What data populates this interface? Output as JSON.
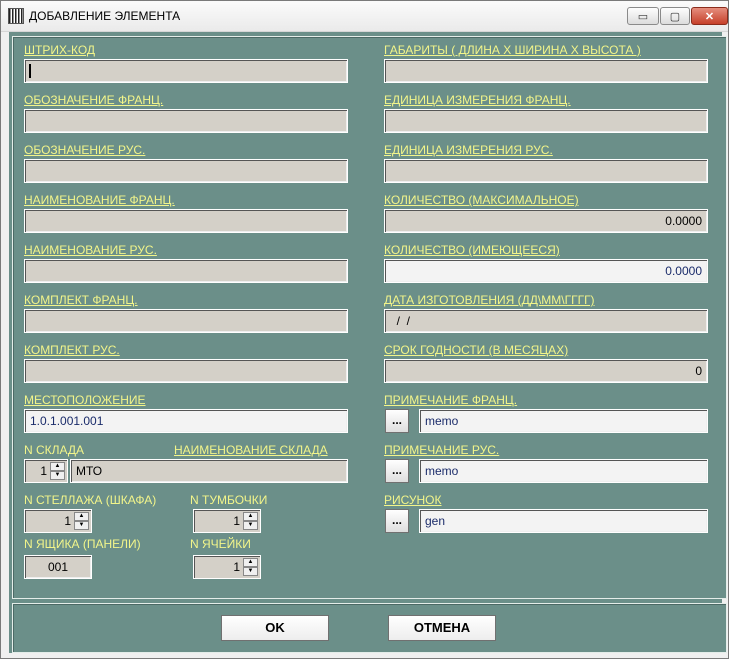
{
  "window": {
    "title": "ДОБАВЛЕНИЕ ЭЛЕМЕНТА",
    "minimize": "▭",
    "maximize": "▢",
    "close": "✕"
  },
  "left": {
    "barcode": {
      "label": "ШТРИХ-КОД",
      "value": ""
    },
    "designation_fr": {
      "label": "ОБОЗНАЧЕНИЕ  ФРАНЦ.",
      "value": ""
    },
    "designation_ru": {
      "label": "ОБОЗНАЧЕНИЕ  РУС.",
      "value": ""
    },
    "name_fr": {
      "label": "НАИМЕНОВАНИЕ  ФРАНЦ.",
      "value": ""
    },
    "name_ru": {
      "label": "НАИМЕНОВАНИЕ  РУС.",
      "value": ""
    },
    "kit_fr": {
      "label": "КОМПЛЕКТ  ФРАНЦ.",
      "value": ""
    },
    "kit_ru": {
      "label": "КОМПЛЕКТ  РУС.",
      "value": ""
    },
    "location": {
      "label": "МЕСТОПОЛОЖЕНИЕ",
      "value": "1.0.1.001.001"
    },
    "warehouse_no": {
      "label": "N  СКЛАДА",
      "value": "1"
    },
    "warehouse_name": {
      "label": "НАИМЕНОВАНИЕ СКЛАДА",
      "value": "МТО"
    },
    "rack_no": {
      "label": "N  СТЕЛЛАЖА (ШКАФА)",
      "value": "1"
    },
    "cabinet_no": {
      "label": "N  ТУМБОЧКИ",
      "value": "1"
    },
    "drawer_no": {
      "label": "N  ЯЩИКА (ПАНЕЛИ)",
      "value": "001"
    },
    "cell_no": {
      "label": "N  ЯЧЕЙКИ",
      "value": "1"
    }
  },
  "right": {
    "dimensions": {
      "label": "ГАБАРИТЫ ( ДЛИНА Х ШИРИНА Х ВЫСОТА )",
      "value": ""
    },
    "unit_fr": {
      "label": "ЕДИНИЦА ИЗМЕРЕНИЯ  ФРАНЦ.",
      "value": ""
    },
    "unit_ru": {
      "label": "ЕДИНИЦА ИЗМЕРЕНИЯ  РУС.",
      "value": ""
    },
    "qty_max": {
      "label": "КОЛИЧЕСТВО (МАКСИМАЛЬНОЕ)",
      "value": "0.0000"
    },
    "qty_available": {
      "label": "КОЛИЧЕСТВО (ИМЕЮЩЕЕСЯ)",
      "value": "0.0000"
    },
    "manufacture_date": {
      "label": "ДАТА ИЗГОТОВЛЕНИЯ  (ДД\\ММ\\ГГГГ)",
      "value": "  /  /"
    },
    "shelf_life": {
      "label": "СРОК ГОДНОСТИ  (В МЕСЯЦАХ)",
      "value": "0"
    },
    "note_fr": {
      "label": "ПРИМЕЧАНИЕ  ФРАНЦ.",
      "button": "...",
      "value": "memo"
    },
    "note_ru": {
      "label": "ПРИМЕЧАНИЕ  РУС.",
      "button": "...",
      "value": "memo"
    },
    "picture": {
      "label": "РИСУНОК",
      "button": "...",
      "value": "gen"
    }
  },
  "buttons": {
    "ok": "OK",
    "cancel": "ОТМЕНА"
  },
  "spin_arrows": {
    "up": "▲",
    "down": "▼"
  }
}
